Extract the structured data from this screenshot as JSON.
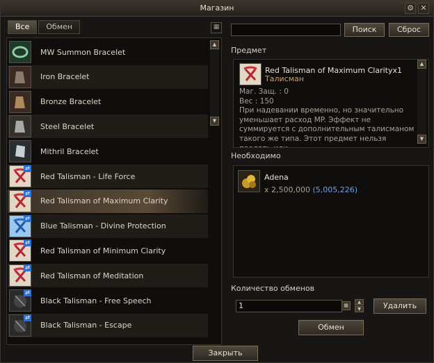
{
  "window": {
    "title": "Магазин"
  },
  "titlebar": {
    "icons": [
      "settings-icon",
      "close-icon"
    ]
  },
  "tabs": [
    {
      "label": "Все",
      "active": true
    },
    {
      "label": "Обмен",
      "active": false
    }
  ],
  "search": {
    "value": "",
    "search_label": "Поиск",
    "reset_label": "Сброс"
  },
  "items": [
    {
      "name": "MW Summon Bracelet",
      "icon": "bracelet-green-icon",
      "exchange": false
    },
    {
      "name": "Iron Bracelet",
      "icon": "bracelet-iron-icon",
      "exchange": false
    },
    {
      "name": "Bronze Bracelet",
      "icon": "bracelet-bronze-icon",
      "exchange": false
    },
    {
      "name": "Steel Bracelet",
      "icon": "bracelet-steel-icon",
      "exchange": false
    },
    {
      "name": "Mithril Bracelet",
      "icon": "bracelet-mithril-icon",
      "exchange": false
    },
    {
      "name": "Red Talisman - Life Force",
      "icon": "red-talisman-icon",
      "exchange": true
    },
    {
      "name": "Red Talisman of Maximum Clarity",
      "icon": "red-talisman-icon",
      "exchange": true,
      "selected": true
    },
    {
      "name": "Blue Talisman - Divine Protection",
      "icon": "blue-talisman-icon",
      "exchange": true
    },
    {
      "name": "Red Talisman of Minimum Clarity",
      "icon": "red-talisman-icon",
      "exchange": true
    },
    {
      "name": "Red Talisman of Meditation",
      "icon": "red-talisman-icon",
      "exchange": true
    },
    {
      "name": "Black Talisman - Free Speech",
      "icon": "black-talisman-icon",
      "exchange": true
    },
    {
      "name": "Black Talisman - Escape",
      "icon": "black-talisman-icon",
      "exchange": true
    }
  ],
  "item_section": {
    "label": "Предмет"
  },
  "detail": {
    "name": "Red Talisman of Maximum Clarity",
    "qty": "x1",
    "type": "Талисман",
    "mdef": "Маг. Защ. : 0",
    "weight": "Вес : 150",
    "description": "При надевании временно, но значительно уменьшает расход MP. Эффект не суммируется с дополнительным талисманом такого же типа. Этот предмет нельзя продать или"
  },
  "required": {
    "label": "Необходимо",
    "item": "Adena",
    "amount": "x 2,500,000",
    "owned": "(5,005,226)"
  },
  "quantity": {
    "label": "Количество обменов",
    "value": "1",
    "delete_label": "Удалить"
  },
  "exchange_button": "Обмен",
  "close_button": "Закрыть"
}
